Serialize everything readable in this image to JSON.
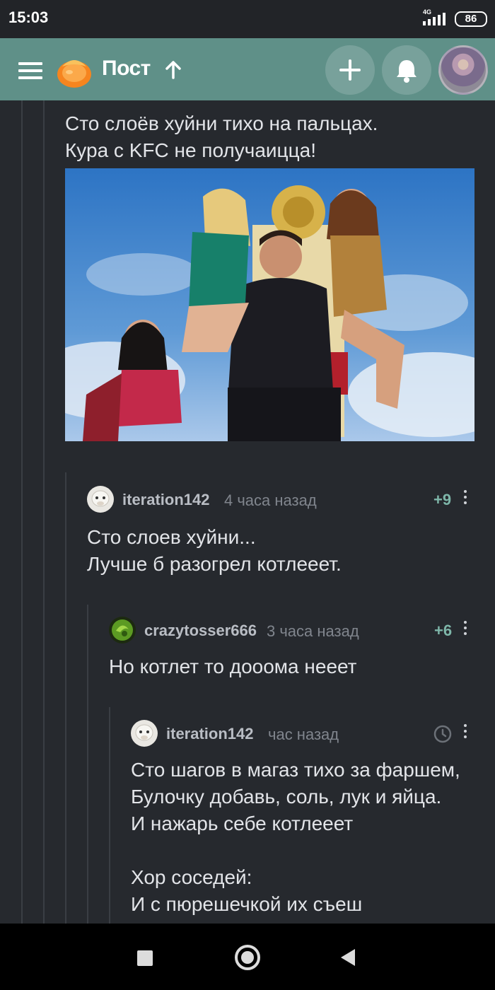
{
  "status": {
    "time": "15:03",
    "network": "4G",
    "battery": "86"
  },
  "header": {
    "title": "Пост",
    "menu_icon": "hamburger-menu-icon",
    "logo_icon": "pikabu-logo-icon",
    "add_icon": "plus-icon",
    "notification_icon": "bell-icon",
    "accent_color": "#5f9088"
  },
  "post_comment": {
    "text": "Сто слоёв хуйни тихо на пальцах.\nКура с KFC не получаицца!"
  },
  "comments": [
    {
      "author": "iteration142",
      "time": "4 часа назад",
      "rating": "+9",
      "text": "Сто слоев хуйни...\nЛучше б разогрел котлееет."
    },
    {
      "author": "crazytosser666",
      "time": "3 часа назад",
      "rating": "+6",
      "text": "Но котлет то дооома нееет"
    },
    {
      "author": "iteration142",
      "time": "час назад",
      "text": "Сто шагов в магаз тихо за фаршем,\nБулочку добавь, соль, лук и яйца.\nИ нажарь себе котлееет\n\nХор соседей:\nИ с пюрешечкой их съеш"
    }
  ]
}
